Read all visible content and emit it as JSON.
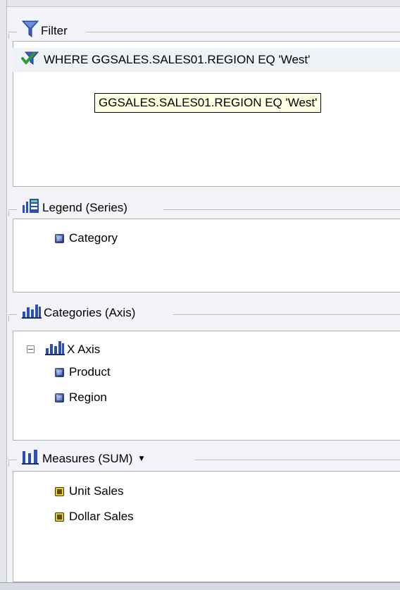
{
  "filter": {
    "title": "Filter",
    "condition": "WHERE GGSALES.SALES01.REGION EQ 'West'",
    "tooltip": "GGSALES.SALES01.REGION EQ 'West'"
  },
  "legend": {
    "title": "Legend (Series)",
    "items": [
      {
        "label": "Category"
      }
    ]
  },
  "categories": {
    "title": "Categories (Axis)",
    "axis": {
      "expander": "−",
      "label": "X Axis"
    },
    "items": [
      {
        "label": "Product"
      },
      {
        "label": "Region"
      }
    ]
  },
  "measures": {
    "title": "Measures (SUM)",
    "dropdown_glyph": "▼",
    "items": [
      {
        "label": "Unit Sales"
      },
      {
        "label": "Dollar Sales"
      }
    ]
  },
  "colors": {
    "filter_funnel": "#3a5cc8",
    "check": "#2f9a2f",
    "measure_icon": "#e8cf18",
    "tooltip_bg": "#ffffe1"
  }
}
